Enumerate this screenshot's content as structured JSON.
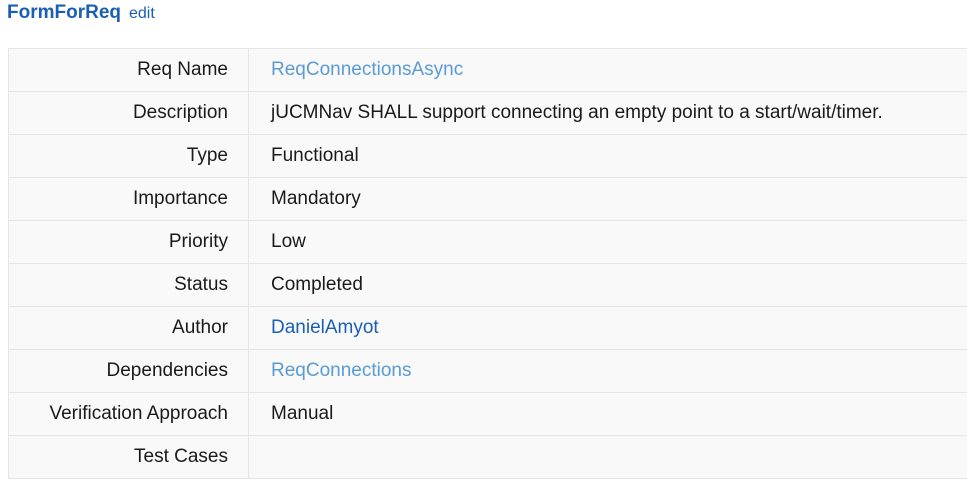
{
  "header": {
    "title": "FormForReq",
    "edit_label": "edit"
  },
  "rows": [
    {
      "label": "Req Name",
      "value": "ReqConnectionsAsync",
      "link": "light"
    },
    {
      "label": "Description",
      "value": "jUCMNav SHALL support connecting an empty point to a start/wait/timer.",
      "link": "none"
    },
    {
      "label": "Type",
      "value": "Functional",
      "link": "none"
    },
    {
      "label": "Importance",
      "value": "Mandatory",
      "link": "none"
    },
    {
      "label": "Priority",
      "value": "Low",
      "link": "none"
    },
    {
      "label": "Status",
      "value": "Completed",
      "link": "none"
    },
    {
      "label": "Author",
      "value": "DanielAmyot",
      "link": "dark"
    },
    {
      "label": "Dependencies",
      "value": "ReqConnections",
      "link": "light"
    },
    {
      "label": "Verification Approach",
      "value": "Manual",
      "link": "none"
    },
    {
      "label": "Test Cases",
      "value": "",
      "link": "none"
    }
  ],
  "colors": {
    "link_primary": "#1a5fb4",
    "link_secondary": "#5a9bd5",
    "table_bg": "#f9f9f9",
    "border": "#e4e4e4"
  }
}
